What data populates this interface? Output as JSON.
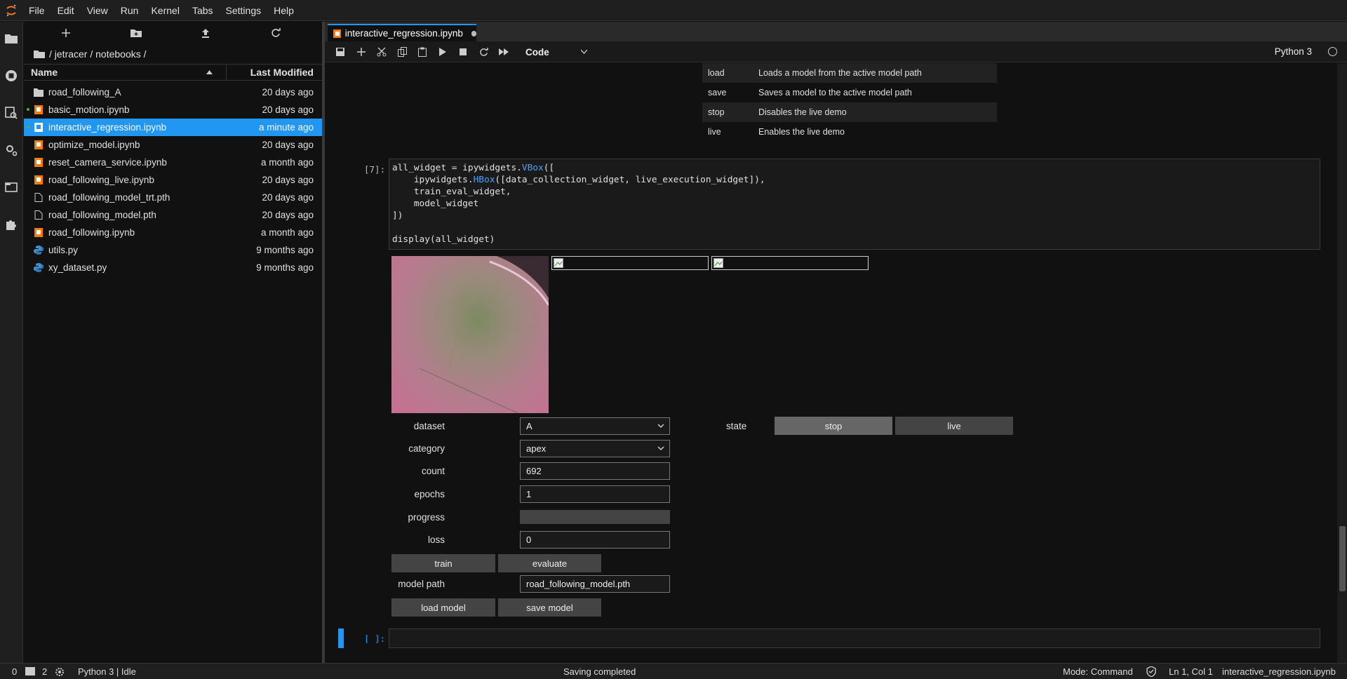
{
  "menu": [
    "File",
    "Edit",
    "View",
    "Run",
    "Kernel",
    "Tabs",
    "Settings",
    "Help"
  ],
  "breadcrumb": "/ jetracer / notebooks /",
  "file_browser": {
    "col_name": "Name",
    "col_modified": "Last Modified",
    "files": [
      {
        "name": "road_following_A",
        "modified": "20 days ago",
        "type": "folder"
      },
      {
        "name": "basic_motion.ipynb",
        "modified": "20 days ago",
        "type": "notebook",
        "running": true
      },
      {
        "name": "interactive_regression.ipynb",
        "modified": "a minute ago",
        "type": "notebook",
        "running": true,
        "selected": true
      },
      {
        "name": "optimize_model.ipynb",
        "modified": "20 days ago",
        "type": "notebook"
      },
      {
        "name": "reset_camera_service.ipynb",
        "modified": "a month ago",
        "type": "notebook"
      },
      {
        "name": "road_following_live.ipynb",
        "modified": "20 days ago",
        "type": "notebook"
      },
      {
        "name": "road_following_model_trt.pth",
        "modified": "20 days ago",
        "type": "file"
      },
      {
        "name": "road_following_model.pth",
        "modified": "20 days ago",
        "type": "file"
      },
      {
        "name": "road_following.ipynb",
        "modified": "a month ago",
        "type": "notebook"
      },
      {
        "name": "utils.py",
        "modified": "9 months ago",
        "type": "python"
      },
      {
        "name": "xy_dataset.py",
        "modified": "9 months ago",
        "type": "python"
      }
    ]
  },
  "tab": {
    "title": "interactive_regression.ipynb"
  },
  "toolbar": {
    "cell_type": "Code",
    "kernel": "Python 3"
  },
  "md_table": [
    {
      "key": "load",
      "desc": "Loads a model from the active model path"
    },
    {
      "key": "save",
      "desc": "Saves a model to the active model path"
    },
    {
      "key": "stop",
      "desc": "Disables the live demo"
    },
    {
      "key": "live",
      "desc": "Enables the live demo"
    }
  ],
  "cell7": {
    "prompt": "[7]:",
    "lines": [
      "all_widget = ipywidgets.VBox([",
      "    ipywidgets.HBox([data_collection_widget, live_execution_widget]),",
      "    train_eval_widget,",
      "    model_widget",
      "])",
      "",
      "display(all_widget)"
    ]
  },
  "widgets": {
    "dataset_label": "dataset",
    "dataset_value": "A",
    "category_label": "category",
    "category_value": "apex",
    "count_label": "count",
    "count_value": "692",
    "epochs_label": "epochs",
    "epochs_value": "1",
    "progress_label": "progress",
    "progress_value": 0,
    "loss_label": "loss",
    "loss_value": "0",
    "train_btn": "train",
    "evaluate_btn": "evaluate",
    "model_path_label": "model path",
    "model_path_value": "road_following_model.pth",
    "load_btn": "load model",
    "save_btn": "save model",
    "state_label": "state",
    "stop_btn": "stop",
    "live_btn": "live"
  },
  "empty_prompt": "[ ]:",
  "status": {
    "left_count1": "0",
    "left_count2": "2",
    "kernel": "Python 3 | Idle",
    "center": "Saving completed",
    "mode": "Mode: Command",
    "position": "Ln 1, Col 1",
    "file": "interactive_regression.ipynb"
  },
  "colors": {
    "accent": "#2196f3",
    "notebook_icon": "#f57c00",
    "python_icon": "#3f8fd2"
  }
}
